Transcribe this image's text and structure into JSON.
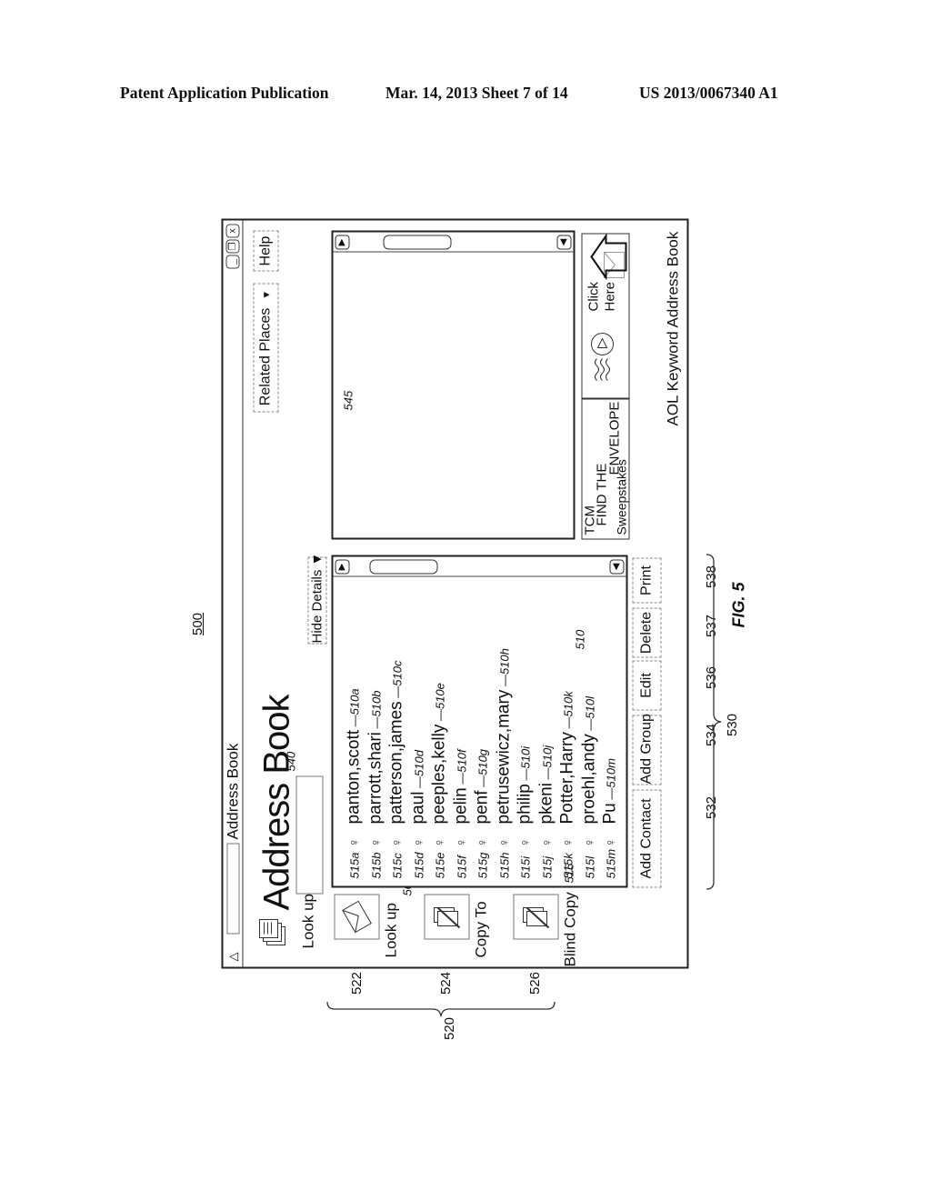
{
  "page_header": {
    "left": "Patent Application Publication",
    "center": "Mar. 14, 2013  Sheet 7 of 14",
    "right": "US 2013/0067340 A1"
  },
  "figure": {
    "number_label": "500",
    "caption": "FIG. 5"
  },
  "window": {
    "title": "Address Book",
    "icons": {
      "app": "aol-triangle-icon",
      "minimize": "minimize-icon",
      "restore": "restore-icon",
      "close": "close-icon"
    },
    "close_glyph": "x",
    "minimize_glyph": "_",
    "heading": "Address Book",
    "lookup_label": "Look up",
    "lookup_value": "",
    "related_places": "Related Places",
    "help": "Help",
    "hide_details": "Hide Details",
    "contacts": [
      {
        "name": "panton,scott",
        "ref": "510a",
        "icon_ref": "515a"
      },
      {
        "name": "parrott,shari",
        "ref": "510b",
        "icon_ref": "515b"
      },
      {
        "name": "patterson,james",
        "ref": "510c",
        "icon_ref": "515c"
      },
      {
        "name": "paul",
        "ref": "510d",
        "icon_ref": "515d"
      },
      {
        "name": "peeples,kelly",
        "ref": "510e",
        "icon_ref": "515e"
      },
      {
        "name": "pelin",
        "ref": "510f",
        "icon_ref": "515f"
      },
      {
        "name": "penf",
        "ref": "510g",
        "icon_ref": "515g"
      },
      {
        "name": "petrusewicz,mary",
        "ref": "510h",
        "icon_ref": "515h"
      },
      {
        "name": "philip",
        "ref": "510i",
        "icon_ref": "515i"
      },
      {
        "name": "pkeni",
        "ref": "510j",
        "icon_ref": "515j"
      },
      {
        "name": "Potter,Harry",
        "ref": "510k",
        "icon_ref": "515k"
      },
      {
        "name": "proehl,andy",
        "ref": "510l",
        "icon_ref": "515l"
      },
      {
        "name": "Pu",
        "ref": "510m",
        "icon_ref": "515m"
      }
    ],
    "side_actions": [
      {
        "label": "Look up",
        "ref": "522",
        "icon": "envelope-icon"
      },
      {
        "label": "Copy To",
        "ref": "524",
        "icon": "copy-document-icon"
      },
      {
        "label": "Blind Copy",
        "ref": "526",
        "icon": "blind-copy-document-icon"
      }
    ],
    "buttons": [
      {
        "label": "Add Contact",
        "ref": "532"
      },
      {
        "label": "Add Group",
        "ref": "534"
      },
      {
        "label": "Edit",
        "ref": "536"
      },
      {
        "label": "Delete",
        "ref": "537"
      },
      {
        "label": "Print",
        "ref": "538"
      }
    ],
    "ad_tcm": {
      "line1": "TCM",
      "line2": "FIND THE",
      "line3": "ENVELOPE",
      "line4": "Sweepstakes"
    },
    "ad_click": {
      "line1": "Click",
      "line2": "Here"
    },
    "footer": "AOL Keyword Address Book"
  },
  "reference_labels": {
    "list_panel": "505",
    "contacts_group": "510",
    "icons_group": "515",
    "side_actions_group": "520",
    "buttons_group": "530",
    "lookup_input": "540",
    "details_pane": "545"
  }
}
